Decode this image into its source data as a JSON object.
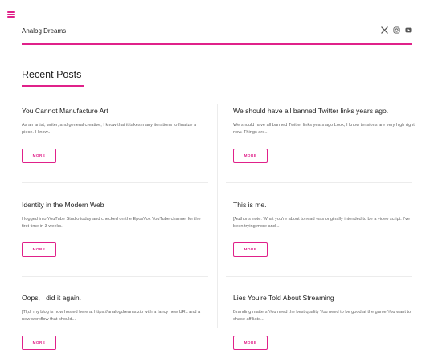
{
  "site": {
    "title": "Analog Dreams",
    "accent_color": "#e0218a",
    "social_icons": [
      "x-twitter-icon",
      "instagram-icon",
      "youtube-icon"
    ]
  },
  "section": {
    "title": "Recent Posts"
  },
  "posts": [
    {
      "title": "You Cannot Manufacture Art",
      "excerpt": "As an artist, writer, and general creative, I know that it takes many iterations to finalize a piece. I know...",
      "button": "MORE"
    },
    {
      "title": "We should have all banned Twitter links years ago.",
      "excerpt": "We should have all banned Twitter links years ago Look, I know tensions are very high right now. Things are...",
      "button": "MORE"
    },
    {
      "title": "Identity in the Modern Web",
      "excerpt": "I logged into YouTube Studio today and checked on the EposVox YouTube channel for the first time in 3 weeks.",
      "button": "MORE"
    },
    {
      "title": "This is me.",
      "excerpt": "[Author's note: What you're about to read was originally intended to be a video script. I've been trying more and...",
      "button": "MORE"
    },
    {
      "title": "Oops, I did it again.",
      "excerpt": "[Tl;dr my blog is now hosted here at https://analogdreams.zip with a fancy new URL and a new workflow that should...",
      "button": "MORE"
    },
    {
      "title": "Lies You're Told About Streaming",
      "excerpt": "Branding matters You need the best quality You need to be good at the game You want to chase affiliate...",
      "button": "MORE"
    }
  ]
}
